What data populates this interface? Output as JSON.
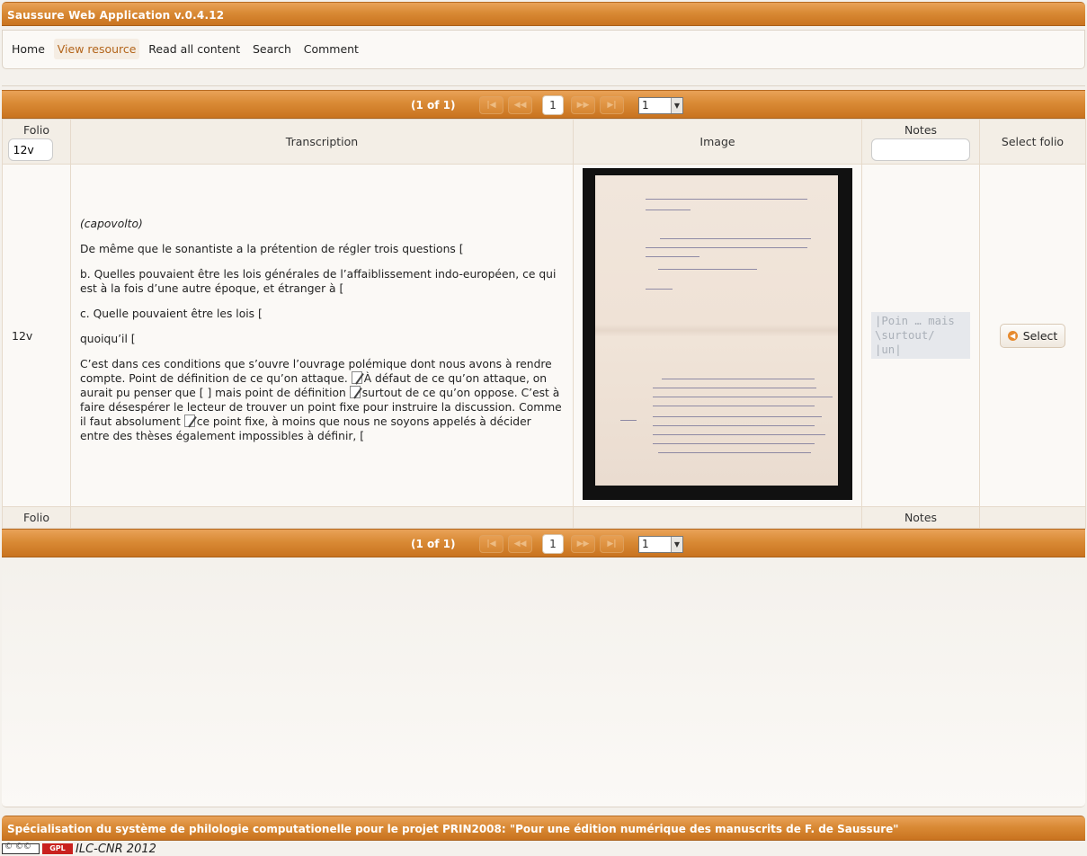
{
  "app": {
    "title": "Saussure Web Application v.0.4.12"
  },
  "menu": {
    "items": [
      {
        "label": "Home"
      },
      {
        "label": "View resource"
      },
      {
        "label": "Read all content"
      },
      {
        "label": "Search"
      },
      {
        "label": "Comment"
      }
    ]
  },
  "paginator": {
    "count": "(1 of 1)",
    "current_page": "1",
    "rows_value": "1",
    "first_icon": "first-page-icon",
    "prev_icon": "previous-page-icon",
    "next_icon": "next-page-icon",
    "last_icon": "last-page-icon"
  },
  "table": {
    "headers": {
      "folio": "Folio",
      "transcription": "Transcription",
      "image": "Image",
      "notes": "Notes",
      "select": "Select folio"
    },
    "filter": {
      "folio_value": "12v",
      "notes_value": ""
    },
    "row": {
      "folio": "12v",
      "transcription": {
        "p1": "(capovolto)",
        "p2": "De même que le sonantiste a la prétention de régler trois questions [",
        "p3": "b. Quelles pouvaient être les lois générales de l’affaiblissement indo-européen, ce qui est à la fois d’une autre époque, et étranger à [",
        "p4": "c. Quelle pouvaient être les lois [",
        "p5": "quoiqu’il [",
        "p6a": "C’est dans ces conditions que s’ouvre l’ouvrage polémique dont nous avons à rendre compte. Point de définition de ce qu’on attaque. ",
        "p6b": "À défaut de ce qu’on attaque, on aurait pu penser que [ ] mais point de définition ",
        "p6c": "surtout de ce qu’on oppose. C’est à faire désespérer le lecteur de trouver un point fixe pour instruire la discussion. Comme il faut absolument ",
        "p6d": "ce point fixe, à moins que nous ne soyons appelés à décider entre des thèses également impossibles à définir, ["
      },
      "notes": [
        "|Poin … mais",
        "\\surtout/",
        "|un|"
      ],
      "select_label": "Select"
    },
    "footer": {
      "folio": "Folio",
      "notes": "Notes"
    }
  },
  "footer": {
    "text": "Spécialisation du système de philologie computationelle pour le projet PRIN2008: \"Pour une édition numérique des manuscrits de F. de Saussure\"",
    "credit": "ILC-CNR 2012"
  }
}
